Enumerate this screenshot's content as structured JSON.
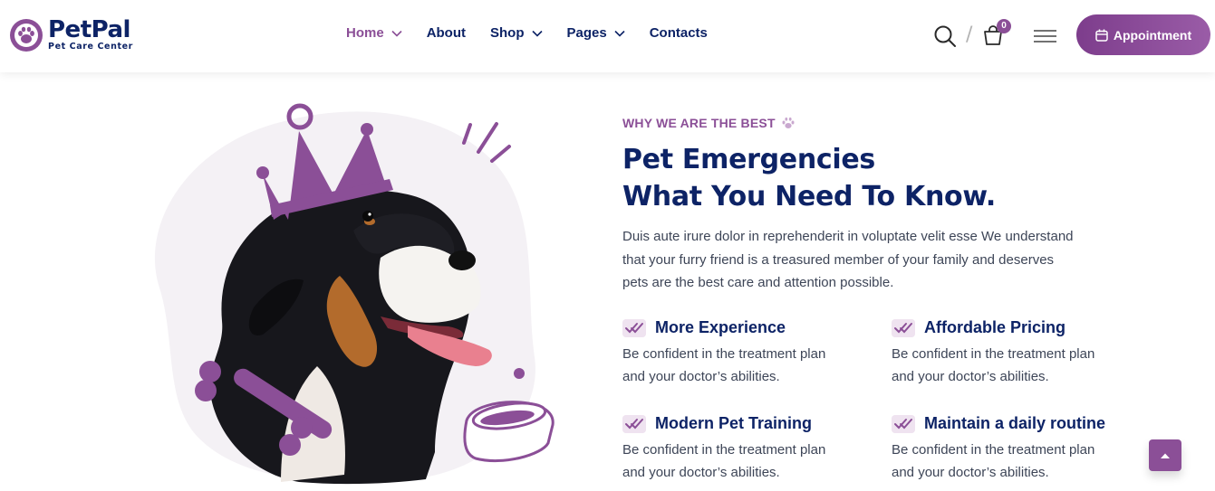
{
  "brand": {
    "name": "PetPal",
    "tagline": "Pet Care Center",
    "icon": "paw-icon",
    "accent": "#8b4f97",
    "navy": "#0d2366"
  },
  "nav": {
    "items": [
      {
        "label": "Home",
        "active": true,
        "dropdown": true
      },
      {
        "label": "About",
        "active": false,
        "dropdown": false
      },
      {
        "label": "Shop",
        "active": false,
        "dropdown": true
      },
      {
        "label": "Pages",
        "active": false,
        "dropdown": true
      },
      {
        "label": "Contacts",
        "active": false,
        "dropdown": false
      }
    ]
  },
  "header": {
    "cart_count": "0",
    "slash": "/",
    "appointment_label": "Appointment"
  },
  "section": {
    "kicker": "WHY WE ARE THE BEST",
    "title_line1": "Pet Emergencies",
    "title_line2": "What You Need To Know.",
    "desc_lines": [
      "Duis aute irure dolor in reprehenderit in voluptate velit esse We understand",
      "that your furry friend is a treasured member of your family and deserves",
      "pets are the best care and attention possible."
    ]
  },
  "features": [
    {
      "title": "More Experience",
      "text_line1": "Be confident in the treatment plan",
      "text_line2": "and your doctor’s abilities."
    },
    {
      "title": "Affordable Pricing",
      "text_line1": "Be confident in the treatment plan",
      "text_line2": "and your doctor’s abilities."
    },
    {
      "title": "Modern Pet Training",
      "text_line1": "Be confident in the treatment plan",
      "text_line2": "and your doctor’s abilities."
    },
    {
      "title": "Maintain a daily routine",
      "text_line1": "Be confident in the treatment plan",
      "text_line2": "and your doctor’s abilities."
    }
  ]
}
